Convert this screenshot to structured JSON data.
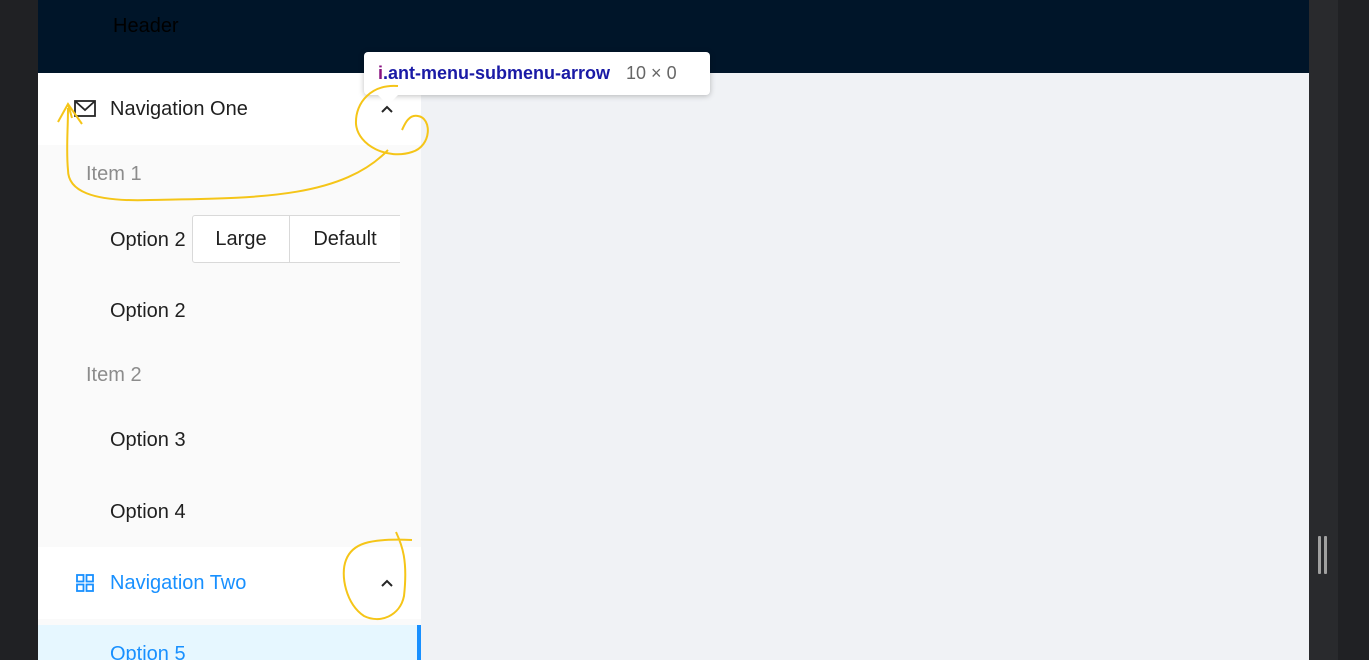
{
  "header": {
    "title": "Header"
  },
  "inspector_tooltip": {
    "tag": "i",
    "class_name": ".ant-menu-submenu-arrow",
    "dimensions": "10 × 0"
  },
  "sider": {
    "submenus": [
      {
        "label": "Navigation One",
        "icon": "mail-icon",
        "expanded": true,
        "groups": [
          {
            "title": "Item 1",
            "items": [
              "Option 2",
              "Option 2"
            ]
          },
          {
            "title": "Item 2",
            "items": [
              "Option 3",
              "Option 4"
            ]
          }
        ]
      },
      {
        "label": "Navigation Two",
        "icon": "appstore-icon",
        "expanded": true,
        "active": true,
        "items": [
          {
            "label": "Option 5",
            "selected": true
          }
        ]
      }
    ]
  },
  "button_group": {
    "buttons": [
      "Large",
      "Default"
    ]
  },
  "colors": {
    "header_bg": "#001529",
    "primary": "#1890ff",
    "selected_bg": "#e6f7ff",
    "sider_bg": "#fafafa",
    "content_bg": "#f0f2f5",
    "annotation": "#f5c518"
  }
}
